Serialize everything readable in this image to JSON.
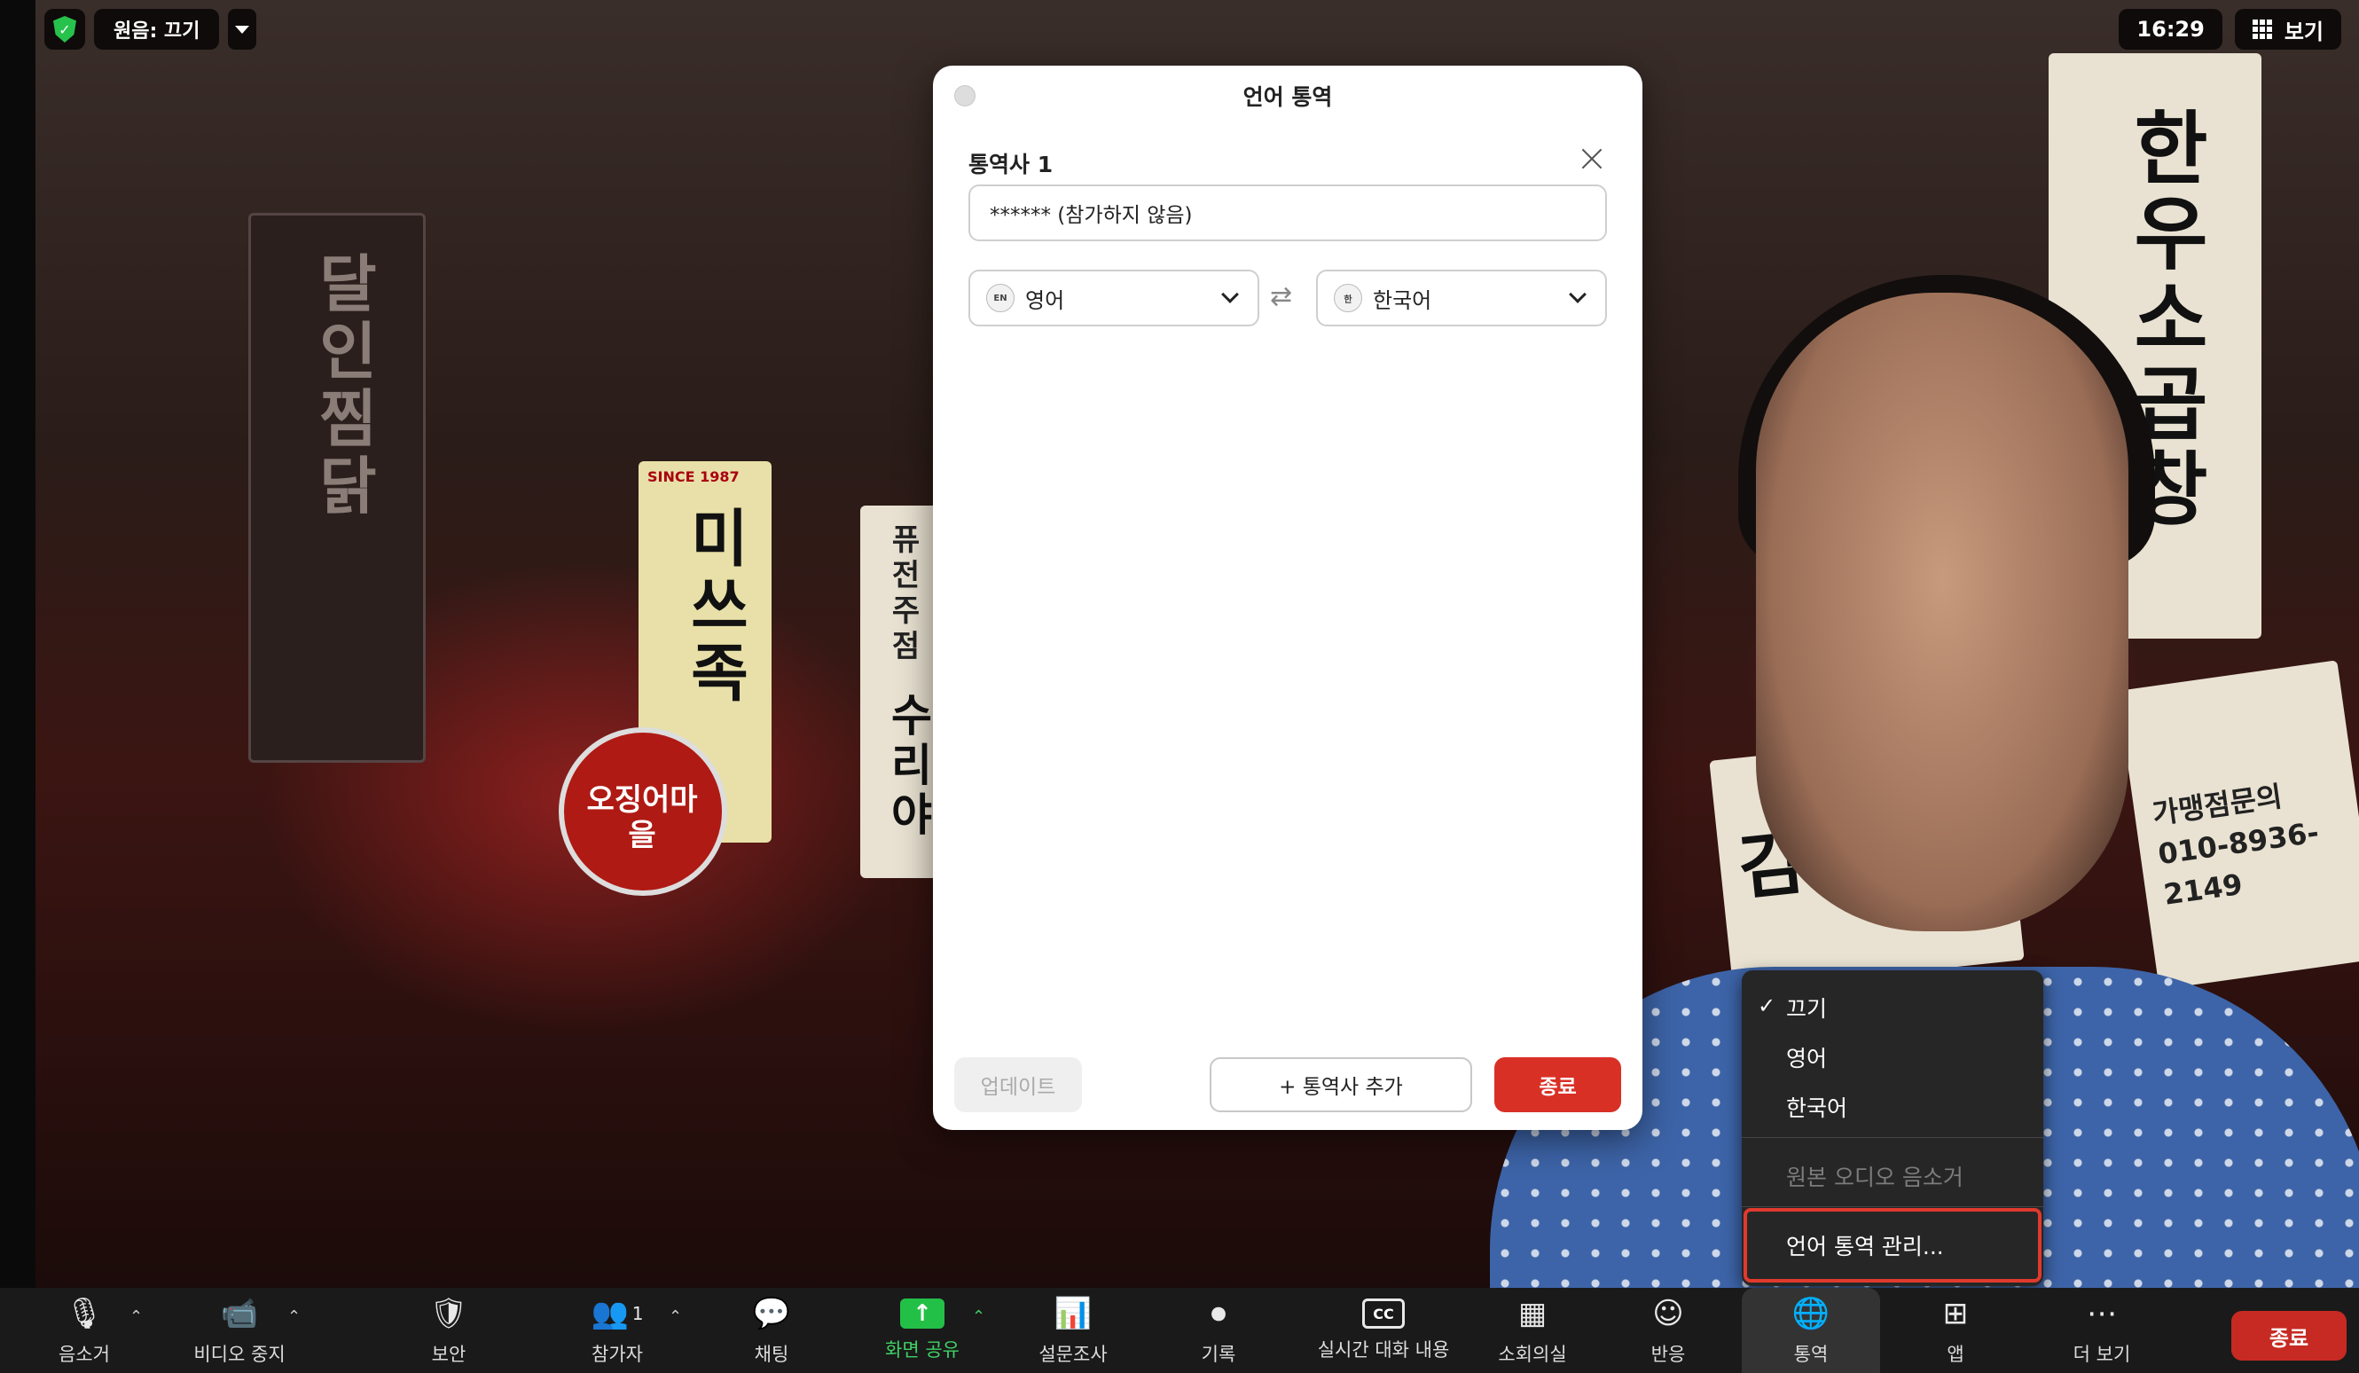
{
  "top_bar": {
    "audio_label": "원음: 끄기",
    "clock": "16:29",
    "view_label": "보기"
  },
  "dialog": {
    "title": "언어 통역",
    "interpreter_label": "통역사 1",
    "interpreter_value": "****** (참가하지 않음)",
    "source_lang_badge": "EN",
    "source_lang": "영어",
    "target_lang_badge": "한",
    "target_lang": "한국어",
    "swap_glyph": "⇄",
    "update_label": "업데이트",
    "add_label": "+ 통역사 추가",
    "end_label": "종료"
  },
  "interp_menu": {
    "items": [
      {
        "label": "끄기",
        "checked": true
      },
      {
        "label": "영어"
      },
      {
        "label": "한국어"
      },
      {
        "label": "원본 오디오 음소거",
        "disabled": true
      },
      {
        "label": "언어 통역 관리...",
        "highlighted": true
      }
    ],
    "check_glyph": "✓"
  },
  "background_signs": {
    "sign_1": "달인찜닭",
    "sign_2": "미쓰족",
    "sign_3": "퓨전주점",
    "sign_4": "수리야",
    "sign_5": "오징어마을",
    "sign_6": "한우소곱창",
    "sign_7": "김치조치",
    "sign_8": "가맹점문의 010-8936-2149",
    "sign_9": "SINCE 1987"
  },
  "toolbar": {
    "mute": "음소거",
    "video": "비디오 중지",
    "security": "보안",
    "participants": "참가자",
    "participants_count": "1",
    "chat": "채팅",
    "share": "화면 공유",
    "polls": "설문조사",
    "record": "기록",
    "captions": "실시간 대화 내용",
    "captions_icon": "CC",
    "breakout": "소회의실",
    "reactions": "반응",
    "interpretation": "통역",
    "apps": "앱",
    "more": "더 보기",
    "end": "종료"
  },
  "colors": {
    "accent_green": "#23c048",
    "end_red": "#d93026",
    "highlight_red": "#e03a2e"
  }
}
